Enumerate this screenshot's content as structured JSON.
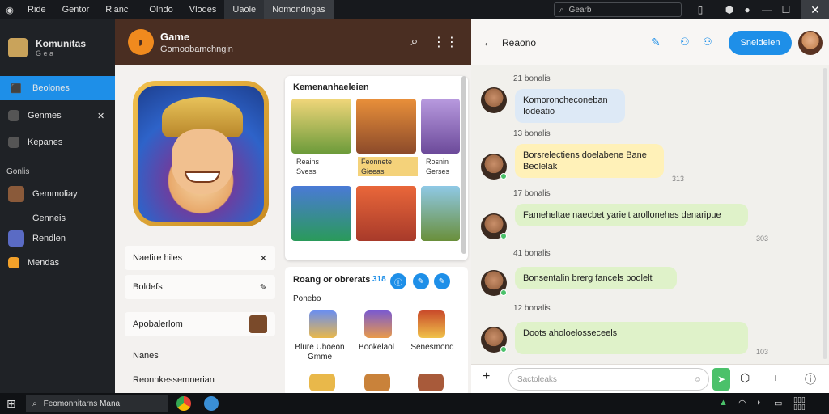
{
  "topbar": {
    "tabs": [
      "Ride",
      "Gentor",
      "Rlanc",
      "Olndo",
      "Vlodes",
      "Uaole",
      "Nomondngas"
    ],
    "search_placeholder": "Gearb"
  },
  "sidebar": {
    "app_name": "Komunitas",
    "app_sub": "G e a",
    "items": [
      {
        "label": "Beolones",
        "icon": "home-icon"
      },
      {
        "label": "Genmes",
        "icon": "game-icon"
      },
      {
        "label": "Kepanes",
        "icon": "folder-icon"
      }
    ],
    "section": "Gonlis",
    "groups": [
      "Gemmoliay",
      "Genneis",
      "Rendlen",
      "Mendas"
    ]
  },
  "game": {
    "title": "Game",
    "subtitle": "Gomoobamchngin",
    "cards": [
      "Naefire hiles",
      "Boldefs",
      "Apobalerlom",
      "Nanes",
      "Reonnkessemnerian"
    ],
    "store_title": "Kemenanhaeleien",
    "tiles": [
      {
        "name": "Reains",
        "sub": "Svess"
      },
      {
        "name": "Feonnete",
        "sub": "Gieeas"
      },
      {
        "name": "Rosnin",
        "sub": "Gerses"
      }
    ],
    "rewards_title": "Roang or obrerats",
    "rewards_count": "318",
    "rewards_sub": "Ponebo",
    "reward_items": [
      "Blure Uhoeon Gmme",
      "Bookelaol",
      "Senesmond"
    ]
  },
  "chat": {
    "name": "Reaono",
    "join_label": "Sneidelen",
    "messages": [
      {
        "sep": "21 bonalis",
        "text": "Komoroncheconeban Iodeatio",
        "time": ""
      },
      {
        "sep": "13 bonalis",
        "text": "Borsrelectiens doelabene Bane Beolelak",
        "time": "313"
      },
      {
        "sep": "17 bonalis",
        "text": "Fameheltae naecbet yarielt arollonehes denaripue",
        "time": "303"
      },
      {
        "sep": "41 bonalis",
        "text": "Bonsentalin brerg fancels boolelt",
        "time": ""
      },
      {
        "sep": "12 bonalis",
        "text": "Doots aholoelosseceels",
        "time": "103"
      }
    ],
    "input_placeholder": "Sactoleaks"
  },
  "taskbar": {
    "search_text": "Feomonnitarns Mana"
  },
  "colors": {
    "accent": "#1e8fe8",
    "header_brown": "#4a2e22",
    "bubble_green": "#dff2c9",
    "bubble_blue": "#dde9f6",
    "bubble_yellow": "#fff1b8"
  }
}
